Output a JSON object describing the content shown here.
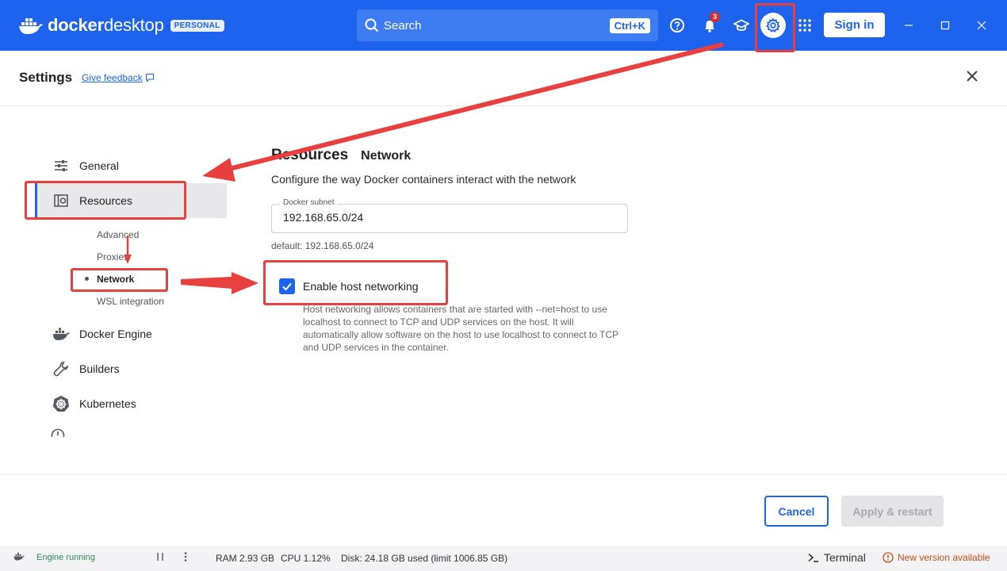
{
  "app": {
    "brand": "docker",
    "product": "desktop",
    "plan_badge": "PERSONAL"
  },
  "topbar": {
    "search_placeholder": "Search",
    "search_shortcut": "Ctrl+K",
    "notification_count": "3",
    "signin_label": "Sign in"
  },
  "header": {
    "title": "Settings",
    "feedback_label": "Give feedback"
  },
  "sidebar": {
    "items": [
      {
        "label": "General",
        "icon": "sliders-icon"
      },
      {
        "label": "Resources",
        "icon": "resources-icon"
      },
      {
        "label": "Docker Engine",
        "icon": "whale-icon"
      },
      {
        "label": "Builders",
        "icon": "wrench-icon"
      },
      {
        "label": "Kubernetes",
        "icon": "helm-icon"
      }
    ],
    "sub_items": [
      "Advanced",
      "Proxies",
      "Network",
      "WSL integration"
    ]
  },
  "content": {
    "breadcrumb_main": "Resources",
    "breadcrumb_sub": "Network",
    "description": "Configure the way Docker containers interact with the network",
    "subnet": {
      "label": "Docker subnet",
      "value": "192.168.65.0/24",
      "help": "default: 192.168.65.0/24"
    },
    "host_networking": {
      "label": "Enable host networking",
      "checked": true,
      "help": "Host networking allows containers that are started with --net=host to use localhost to connect to TCP and UDP services on the host. It will automatically allow software on the host to use localhost to connect to TCP and UDP services in the container."
    }
  },
  "footer": {
    "cancel_label": "Cancel",
    "apply_label": "Apply & restart"
  },
  "statusbar": {
    "engine": "Engine running",
    "ram": "RAM 2.93 GB",
    "cpu": "CPU 1.12%",
    "disk": "Disk: 24.18 GB used (limit 1006.85 GB)",
    "terminal": "Terminal",
    "update": "New version available"
  },
  "colors": {
    "brand_blue": "#1d63ed",
    "annotation_red": "#e8403f",
    "engine_green": "#2e8b57",
    "update_orange": "#c0501a"
  }
}
